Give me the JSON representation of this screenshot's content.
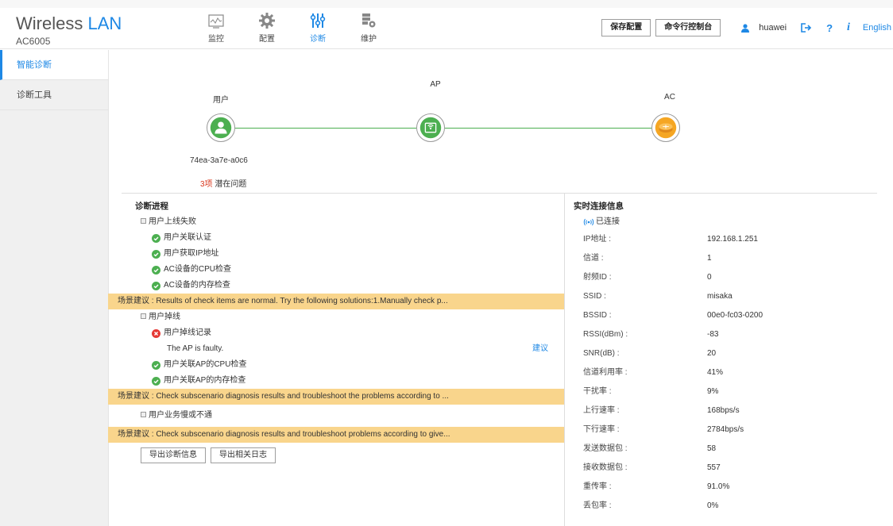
{
  "app": {
    "title_main": "Wireless",
    "title_accent": "LAN",
    "model": "AC6005"
  },
  "nav": [
    {
      "label": "监控",
      "icon": "monitor-icon"
    },
    {
      "label": "配置",
      "icon": "gear-icon"
    },
    {
      "label": "诊断",
      "icon": "diagnose-icon",
      "active": true
    },
    {
      "label": "维护",
      "icon": "maintenance-icon"
    }
  ],
  "header": {
    "save_label": "保存配置",
    "console_label": "命令行控制台",
    "username": "huawei",
    "help_label": "?",
    "info_label": "i",
    "language": "English"
  },
  "sidebar": {
    "items": [
      {
        "label": "智能诊断",
        "active": true
      },
      {
        "label": "诊断工具"
      }
    ]
  },
  "topology": {
    "user_label": "用户",
    "ap_label": "AP",
    "ac_label": "AC",
    "mac": "74ea-3a7e-a0c6",
    "issue_count": "3项",
    "issue_text": "潜在问题"
  },
  "diag": {
    "title": "诊断进程",
    "groups": [
      {
        "name": "用户上线失败",
        "checks": [
          {
            "label": "用户关联认证",
            "status": "ok"
          },
          {
            "label": "用户获取IP地址",
            "status": "ok"
          },
          {
            "label": "AC设备的CPU检查",
            "status": "ok"
          },
          {
            "label": "AC设备的内存检查",
            "status": "ok"
          }
        ],
        "suggestion": "场景建议 : Results of check items are normal. Try the following solutions:1.Manually check p..."
      },
      {
        "name": "用户掉线",
        "checks": [
          {
            "label": "用户掉线记录",
            "status": "fail",
            "detail": "The AP is faulty.",
            "link": "建议"
          },
          {
            "label": "用户关联AP的CPU检查",
            "status": "ok"
          },
          {
            "label": "用户关联AP的内存检查",
            "status": "ok"
          }
        ],
        "suggestion": "场景建议 : Check subscenario diagnosis results and troubleshoot the problems according to ..."
      },
      {
        "name": "用户业务慢或不通",
        "checks": [],
        "suggestion": "场景建议 : Check subscenario diagnosis results and troubleshoot problems according to give..."
      }
    ],
    "export_diag_label": "导出诊断信息",
    "export_log_label": "导出相关日志"
  },
  "info": {
    "title": "实时连接信息",
    "status": "已连接",
    "rows": [
      {
        "k": "IP地址 :",
        "v": "192.168.1.251"
      },
      {
        "k": "信道 :",
        "v": "1"
      },
      {
        "k": "射频ID :",
        "v": "0"
      },
      {
        "k": "SSID :",
        "v": "misaka"
      },
      {
        "k": "BSSID :",
        "v": "00e0-fc03-0200"
      },
      {
        "k": "RSSI(dBm) :",
        "v": "-83"
      },
      {
        "k": "SNR(dB) :",
        "v": "20"
      },
      {
        "k": "信道利用率 :",
        "v": "41%"
      },
      {
        "k": "干扰率 :",
        "v": "9%"
      },
      {
        "k": "上行速率 :",
        "v": "168bps/s"
      },
      {
        "k": "下行速率 :",
        "v": "2784bps/s"
      },
      {
        "k": "发送数据包 :",
        "v": "58"
      },
      {
        "k": "接收数据包 :",
        "v": "557"
      },
      {
        "k": "重传率 :",
        "v": "91.0%"
      },
      {
        "k": "丢包率 :",
        "v": "0%"
      }
    ]
  },
  "colors": {
    "accent": "#1e88e5",
    "ok": "#4caf50",
    "fail": "#e53935",
    "banner": "#f9d58c",
    "issue": "#d9381e"
  }
}
